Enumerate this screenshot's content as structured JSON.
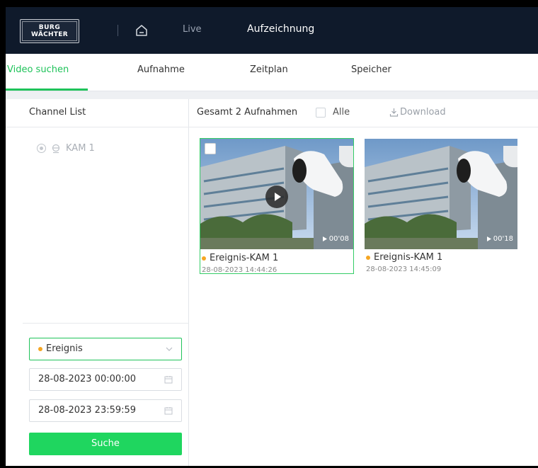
{
  "header": {
    "logo_line1": "BURG",
    "logo_line2": "WÄCHTER",
    "nav": {
      "live": "Live",
      "recording": "Aufzeichnung"
    }
  },
  "tabs": [
    {
      "label": "Video suchen",
      "active": true
    },
    {
      "label": "Aufnahme"
    },
    {
      "label": "Zeitplan"
    },
    {
      "label": "Speicher"
    }
  ],
  "left_panel": {
    "title": "Channel List",
    "channels": [
      {
        "label": "KAM 1",
        "icon": "camera-icon"
      }
    ],
    "event_type": "Ereignis",
    "start_time": "28-08-2023 00:00:00",
    "end_time": "28-08-2023 23:59:59",
    "search_label": "Suche"
  },
  "results": {
    "total_label": "Gesamt 2 Aufnahmen",
    "select_all_label": "Alle",
    "download_label": "Download",
    "items": [
      {
        "title": "Ereignis-KAM 1",
        "time": "28-08-2023 14:44:26",
        "duration": "00'08"
      },
      {
        "title": "Ereignis-KAM 1",
        "time": "28-08-2023 14:45:09",
        "duration": "00'18"
      }
    ]
  },
  "colors": {
    "accent": "#1fc35a",
    "button": "#1fd65f",
    "topbar": "#0f1a2b",
    "event_dot": "#f5a623"
  }
}
